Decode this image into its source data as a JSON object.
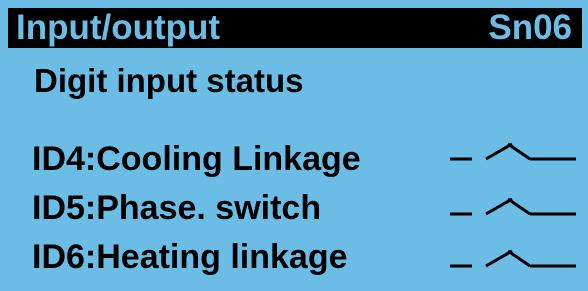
{
  "header": {
    "title": "Input/output",
    "page_code": "Sn06"
  },
  "section": {
    "title": "Digit input status"
  },
  "inputs": [
    {
      "label": "ID4:Cooling Linkage",
      "state": "open",
      "icon": "open-switch-icon"
    },
    {
      "label": "ID5:Phase. switch",
      "state": "open",
      "icon": "open-switch-icon"
    },
    {
      "label": "ID6:Heating linkage",
      "state": "open",
      "icon": "open-switch-icon"
    }
  ],
  "colors": {
    "background": "#6bbde6",
    "title_bar": "#000000",
    "text": "#000000"
  }
}
